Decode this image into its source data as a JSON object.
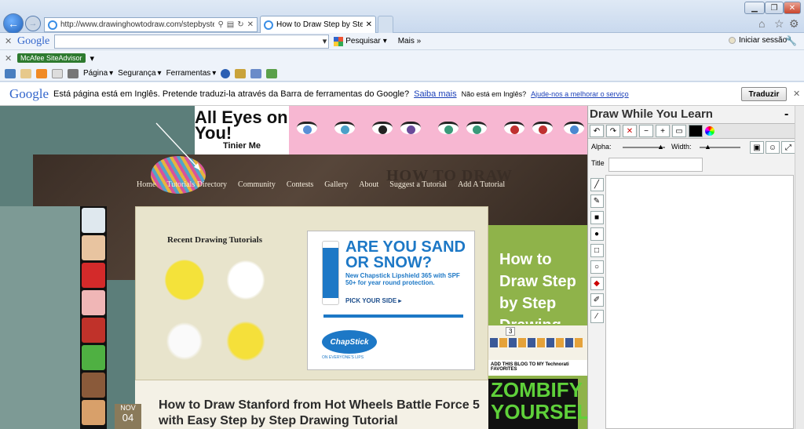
{
  "window": {
    "url": "http://www.drawinghowtodraw.com/stepbystep",
    "tab_title": "How to Draw Step by Step ...",
    "minimize": "▁",
    "maximize": "❐",
    "close": "✕"
  },
  "google_toolbar": {
    "logo": "Google",
    "search_value": "",
    "pesquisar": "Pesquisar",
    "mais": "Mais",
    "login": "Iniciar sessão"
  },
  "mcafee": {
    "label": "McAfee SiteAdvisor"
  },
  "command_bar": {
    "pagina": "Página",
    "seguranca": "Segurança",
    "ferramentas": "Ferramentas"
  },
  "translate_bar": {
    "logo": "Google",
    "message": "Está página está em Inglês.  Pretende traduzi-la através da Barra de ferramentas do Google?",
    "saiba_mais": "Saiba mais",
    "not_english": "Não está em Inglês?",
    "help_link": "Ajude-nos a melhorar o serviço",
    "button": "Traduzir"
  },
  "banner": {
    "title": "All Eyes on You!",
    "subtitle": "Tinier Me"
  },
  "site": {
    "header_title": "HOW TO DRAW",
    "nav": [
      "Home",
      "Tutorials Directory",
      "Community",
      "Contests",
      "Gallery",
      "About",
      "Suggest a Tutorial",
      "Add A Tutorial"
    ],
    "recent_title": "Recent Drawing Tutorials",
    "side_heading": "How to Draw Step by Step Drawing Tutorials",
    "social_count": "3",
    "technorati": "ADD THIS BLOG TO MY Technorati FAVORITES",
    "zombify": "ZOMBIFY YOURSELF",
    "post_title": "How to Draw Stanford from Hot Wheels Battle Force 5 with Easy Step by Step Drawing Tutorial",
    "date_month": "NOV",
    "date_day": "04"
  },
  "ad": {
    "headline": "ARE YOU SAND OR SNOW?",
    "body": "New Chapstick Lipshield 365 with SPF 50+ for year round protection.",
    "cta": "PICK YOUR SIDE ▸",
    "brand": "ChapStick",
    "tagline": "ON EVERYONE'S LIPS"
  },
  "draw_panel": {
    "title": "Draw While You Learn",
    "minimize": "-",
    "alpha_label": "Alpha:",
    "width_label": "Width:",
    "title_label": "Title",
    "title_value": ""
  }
}
